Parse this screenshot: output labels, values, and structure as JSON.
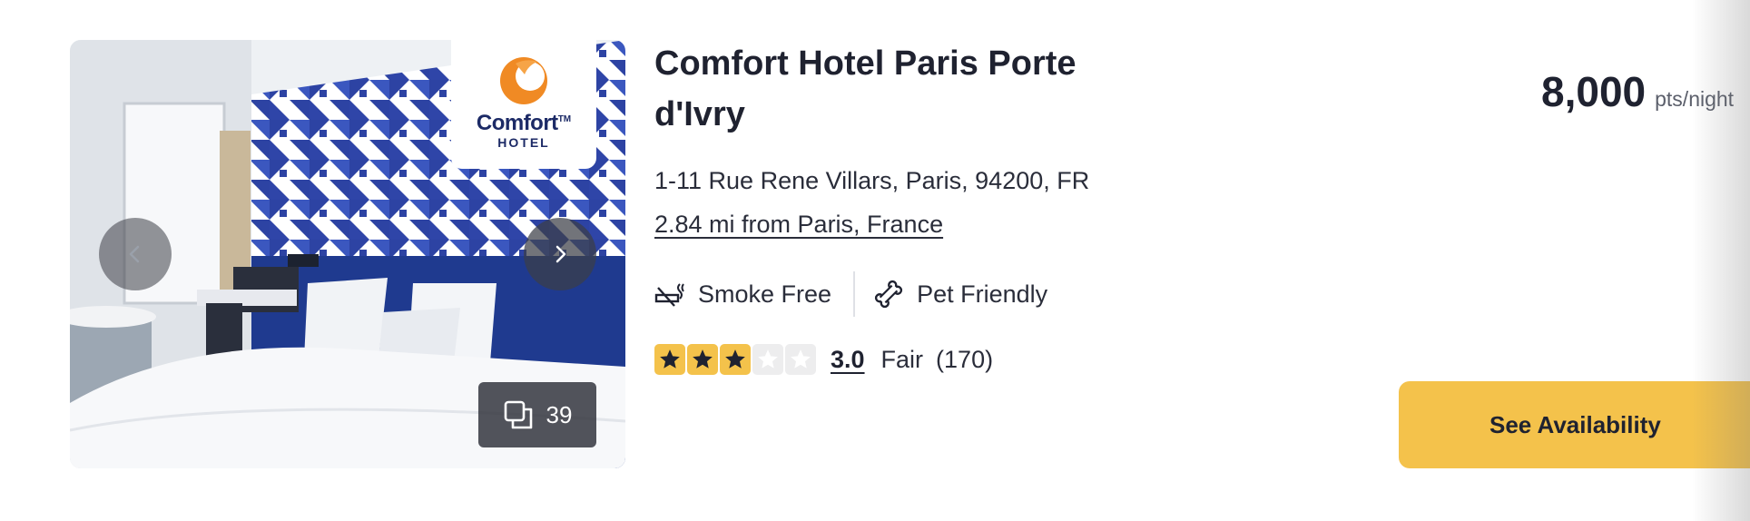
{
  "hotel": {
    "name": "Comfort Hotel Paris Porte d'Ivry",
    "address": "1-11 Rue Rene Villars, Paris, 94200, FR",
    "distance": "2.84 mi from Paris, France",
    "brand_logo": {
      "word": "Comfort",
      "trademark": "TM",
      "sub": "HOTEL"
    }
  },
  "gallery": {
    "photo_count": "39",
    "prev_icon": "chevron-left-icon",
    "next_icon": "chevron-right-icon"
  },
  "amenities": [
    {
      "icon": "smoke-free-icon",
      "label": "Smoke Free"
    },
    {
      "icon": "pet-bone-icon",
      "label": "Pet Friendly"
    }
  ],
  "rating": {
    "stars_filled": 3,
    "stars_total": 5,
    "score": "3.0",
    "label": "Fair",
    "reviews": "(170)"
  },
  "price": {
    "value": "8,000",
    "unit": "pts/night"
  },
  "cta": {
    "label": "See Availability"
  },
  "colors": {
    "accent": "#f4c24b",
    "text": "#1f2230",
    "logo_navy": "#1c2a66",
    "logo_orange": "#f08a24"
  }
}
